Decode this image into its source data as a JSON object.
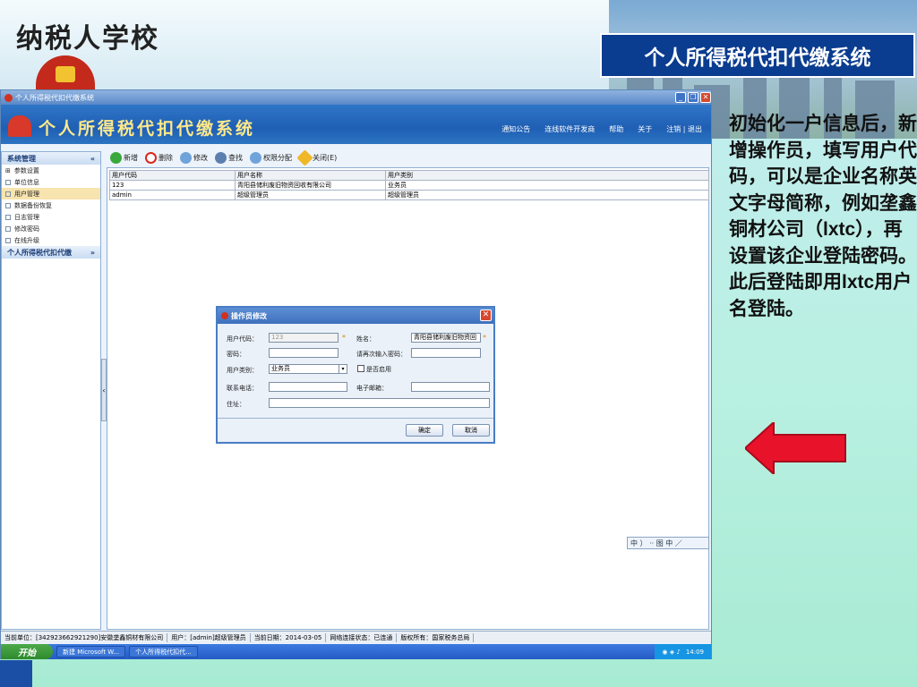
{
  "slide": {
    "school_name": "纳税人学校",
    "title": "个人所得税代扣代缴系统",
    "description": "初始化一户信息后，新增操作员，填写用户代码，可以是企业名称英文字母简称，例如垄鑫铜材公司（lxtc），再设置该企业登陆密码。此后登陆即用lxtc用户名登陆。",
    "arrow_color": "#e8132b"
  },
  "window": {
    "title": "个人所得税代扣代缴系统",
    "banner_title": "个人所得税代扣代缴系统",
    "nav": [
      "通知公告",
      "连线软件开发商",
      "帮助",
      "关于",
      "注销 | 退出"
    ]
  },
  "toolbar": [
    "新增",
    "删除",
    "修改",
    "查找",
    "权限分配",
    "关闭(E)"
  ],
  "sidebar": {
    "section1": "系统管理",
    "items": [
      "参数设置",
      "单位信息",
      "用户管理",
      "数据备份恢复",
      "日志管理",
      "修改密码",
      "在线升级"
    ],
    "section2": "个人所得税代扣代缴"
  },
  "grid": {
    "headers": [
      "用户代码",
      "用户名称",
      "用户类别"
    ],
    "rows": [
      [
        "123",
        "青阳县储利废旧物资回收有限公司",
        "业务员"
      ],
      [
        "admin",
        "超级管理员",
        "超级管理员"
      ]
    ]
  },
  "dialog": {
    "title": "操作员修改",
    "user_code_label": "用户代码：",
    "user_code_value": "123",
    "name_label": "姓名：",
    "name_value": "青阳县储利废旧物资回",
    "password_label": "密码：",
    "confirm_password_label": "请再次输入密码：",
    "user_type_label": "用户类别：",
    "user_type_value": "业务员",
    "disable_label": "是否启用",
    "phone_label": "联系电话：",
    "email_label": "电子邮箱：",
    "address_label": "住址：",
    "ok": "确定",
    "cancel": "取消"
  },
  "statusbar": [
    "当前单位：[342923662921290]安徽垄鑫铜材有限公司",
    "用户：[admin]超级管理员",
    "当前日期：2014-03-05",
    "网络连接状态：已连通",
    "版权所有：国家税务总局"
  ],
  "taskbar": {
    "start": "开始",
    "tasks": [
      "新建 Microsoft W...",
      "个人所得税代扣代..."
    ],
    "clock": "14:09"
  },
  "ime": "中 ） ·· 图 中 ／"
}
